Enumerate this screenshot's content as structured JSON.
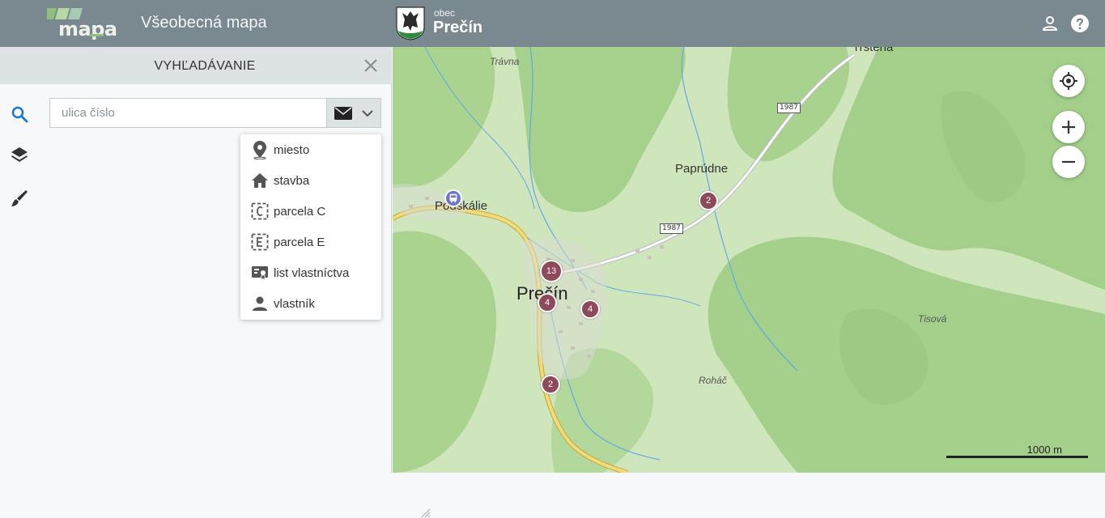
{
  "header": {
    "logo_text": "mapa",
    "app_title": "Všeobecná mapa",
    "municipality_type": "obec",
    "municipality_name": "Prečín",
    "icons": [
      "account-icon",
      "help-icon"
    ]
  },
  "rail": {
    "items": [
      {
        "name": "search",
        "icon": "search-icon",
        "active": true
      },
      {
        "name": "layers",
        "icon": "layers-icon",
        "active": false
      },
      {
        "name": "draw",
        "icon": "brush-icon",
        "active": false
      }
    ]
  },
  "panel": {
    "title": "VYHĽADÁVANIE",
    "search": {
      "placeholder": "ulica číslo",
      "value": ""
    },
    "search_type_icon": "mail-icon"
  },
  "dropdown": {
    "items": [
      {
        "label": "miesto",
        "icon": "place-icon"
      },
      {
        "label": "stavba",
        "icon": "home-icon"
      },
      {
        "label": "parcela C",
        "icon": "parcel-c-icon"
      },
      {
        "label": "parcela E",
        "icon": "parcel-e-icon"
      },
      {
        "label": "list vlastníctva",
        "icon": "ownership-sheet-icon"
      },
      {
        "label": "vlastník",
        "icon": "person-icon"
      }
    ]
  },
  "map": {
    "labels": {
      "travna": "Trávna",
      "trstena": "Trstená",
      "paprudne": "Paprúdne",
      "podskalie": "Podskálie",
      "precin": "Prečín",
      "tisova": "Tisová",
      "rohac": "Roháč"
    },
    "road_numbers": [
      "1987",
      "1987"
    ],
    "clusters": [
      "2",
      "13",
      "4",
      "4",
      "2"
    ],
    "scale_label": "1000 m",
    "colors": {
      "cluster": "#8e4a5a",
      "bus_stop": "#6b76c8",
      "header": "#7a8890",
      "accent": "#1976d2"
    }
  }
}
